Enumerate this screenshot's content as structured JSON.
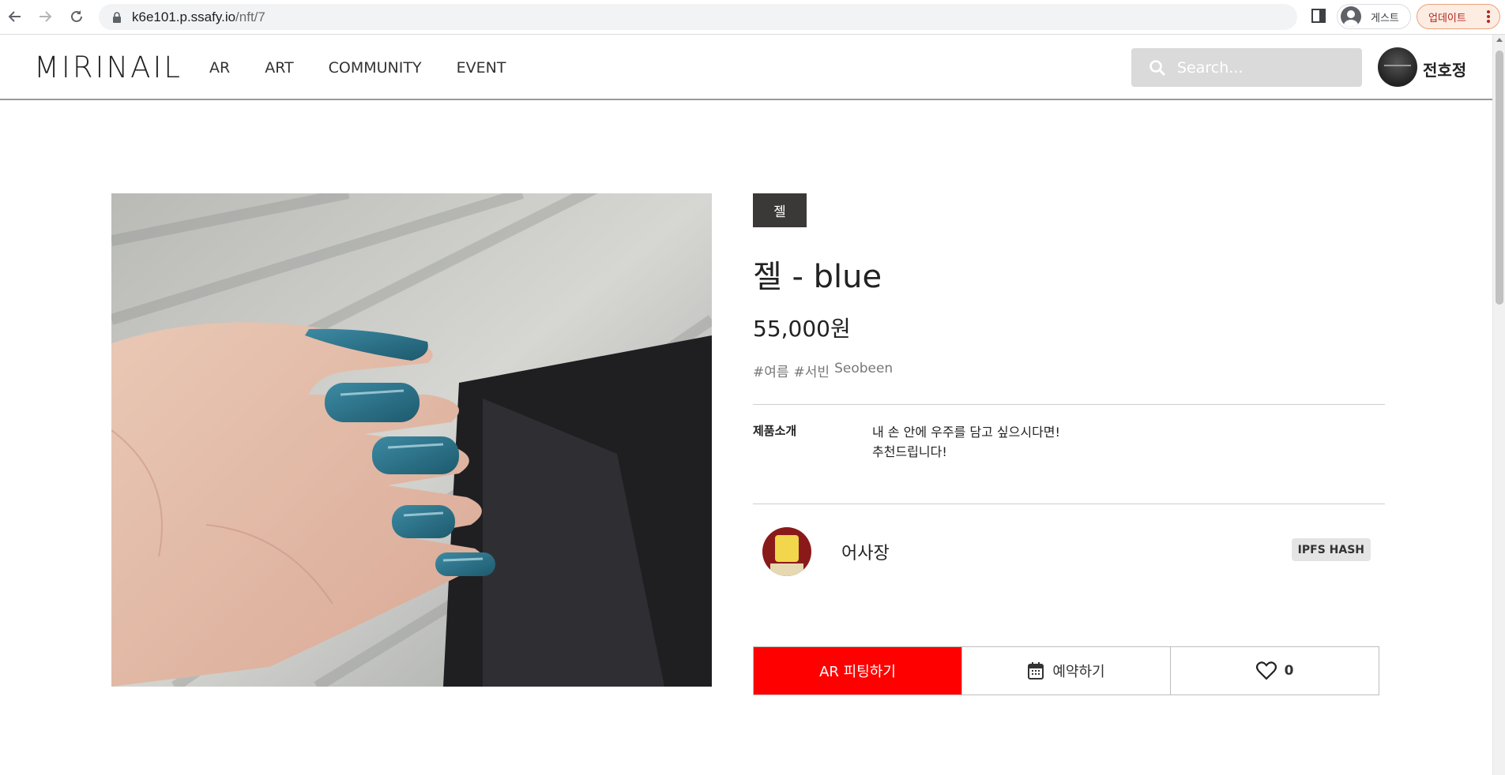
{
  "browser": {
    "url_host": "k6e101.p.ssafy.io",
    "url_path": "/nft/7",
    "guest_label": "게스트",
    "update_label": "업데이트"
  },
  "header": {
    "logo": "MIRINAIL",
    "menu": [
      "AR",
      "ART",
      "COMMUNITY",
      "EVENT"
    ],
    "search_placeholder": "Search...",
    "user_name": "전호정"
  },
  "product": {
    "category": "젤",
    "title": "젤 - blue",
    "price": "55,000원",
    "tags": [
      "#여름",
      "#서빈",
      "Seobeen"
    ],
    "description_label": "제품소개",
    "description_lines": [
      "내 손 안에 우주를 담고 싶으시다면!",
      "추천드립니다!"
    ],
    "seller_name": "어사장",
    "ipfs_label": "IPFS HASH"
  },
  "actions": {
    "ar_fitting": "AR 피팅하기",
    "reserve": "예약하기",
    "like_count": "0"
  },
  "colors": {
    "accent_red": "#ff0000",
    "badge_dark": "#3b3838",
    "nail_blue": "#2a6f86"
  }
}
